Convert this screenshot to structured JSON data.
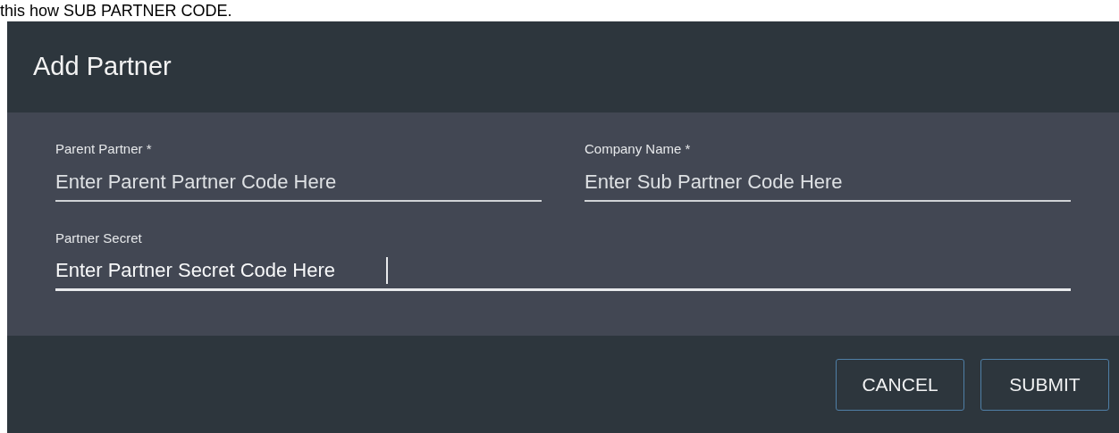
{
  "page_text": "this how SUB PARTNER CODE.",
  "dialog": {
    "title": "Add Partner",
    "fields": [
      {
        "label": "Parent Partner *",
        "placeholder": "Enter Parent Partner Code Here",
        "focused": false
      },
      {
        "label": "Company Name *",
        "placeholder": "Enter Sub Partner Code Here",
        "focused": false
      },
      {
        "label": "Partner Secret",
        "placeholder": "Enter Partner Secret Code Here",
        "focused": true
      }
    ],
    "buttons": [
      "CANCEL",
      "SUBMIT"
    ]
  }
}
